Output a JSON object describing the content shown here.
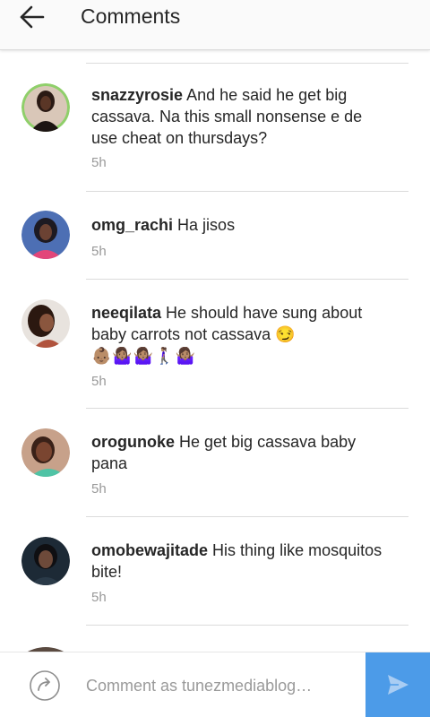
{
  "header": {
    "title": "Comments",
    "back_icon": "arrow-left-icon"
  },
  "comments": [
    {
      "username": "snazzyrosie",
      "text": "And he said he get big cassava. Na this small nonsense e de use cheat on thursdays?",
      "time": "5h"
    },
    {
      "username": "omg_rachi",
      "text": "Ha jisos",
      "time": "5h"
    },
    {
      "username": "neeqilata",
      "text": "He should have sung about baby carrots not cassava 😏",
      "emoji_line": "👶🏽🤷🏽‍♀️🤷🏽‍♀️🚶🏽‍♀️🤷🏽‍♀️",
      "time": "5h"
    },
    {
      "username": "orogunoke",
      "text": "He get big cassava baby pana",
      "time": "5h"
    },
    {
      "username": "omobewajitade",
      "text": "His thing like mosquitos bite!",
      "time": "5h"
    }
  ],
  "composer": {
    "placeholder": "Comment as tunezmediablog…",
    "reply_icon": "reply-circle-icon",
    "send_icon": "send-icon",
    "send_color": "#4c9be8"
  }
}
